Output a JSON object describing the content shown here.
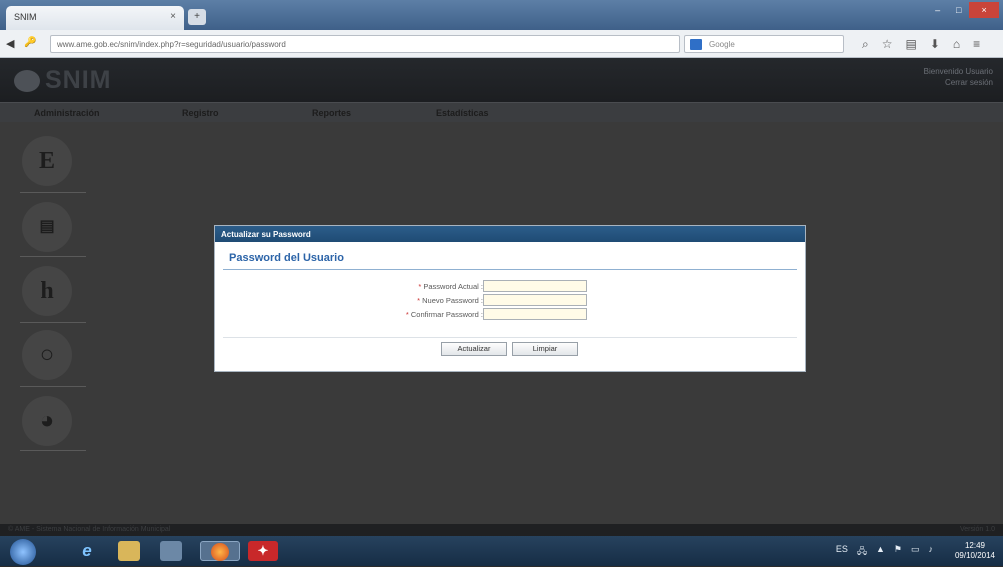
{
  "browser": {
    "tab_title": "SNIM",
    "tab_close": "×",
    "new_tab": "+",
    "window_controls": [
      "–",
      "□",
      "×"
    ],
    "url": "www.ame.gob.ec/snim/index.php?r=seguridad/usuario/password",
    "search_placeholder": "Google",
    "nav_back": "◀",
    "nav_site_icon": "🔑"
  },
  "app": {
    "logo": "SNIM",
    "user_line1": "Bienvenido Usuario",
    "user_line2": "Cerrar sesión"
  },
  "menu": {
    "items": [
      "Administración",
      "Registro",
      "Reportes",
      "Estadísticas"
    ]
  },
  "dialog": {
    "title": "Actualizar su Password",
    "heading": "Password del Usuario",
    "fields": [
      {
        "label": "Password Actual :",
        "required": "*"
      },
      {
        "label": "Nuevo Password :",
        "required": "*"
      },
      {
        "label": "Confirmar Password :",
        "required": "*"
      }
    ],
    "buttons": {
      "update": "Actualizar",
      "clear": "Limpiar"
    }
  },
  "statusbar": {
    "left": "© AME - Sistema Nacional de Información Municipal",
    "right": "Versión 1.0"
  },
  "taskbar": {
    "tray_lang": "ES",
    "clock_time": "12:49",
    "clock_date": "09/10/2014"
  }
}
